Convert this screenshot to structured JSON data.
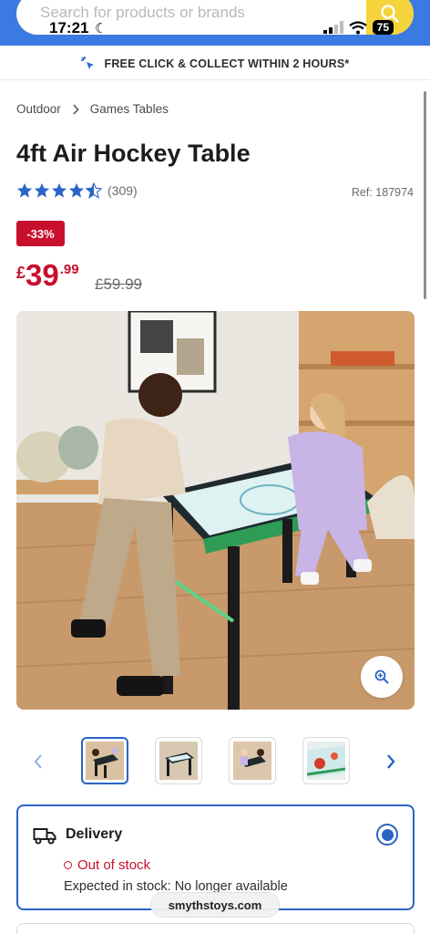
{
  "status_bar": {
    "time": "17:21",
    "battery": "75"
  },
  "search": {
    "placeholder": "Search for products or brands"
  },
  "promo": {
    "text": "FREE CLICK & COLLECT WITHIN 2 HOURS*"
  },
  "breadcrumb": {
    "items": [
      "Outdoor",
      "Games Tables"
    ]
  },
  "product": {
    "title": "4ft Air Hockey Table",
    "rating": 4.5,
    "review_count": "(309)",
    "ref": "Ref: 187974",
    "discount": "-33%",
    "price_currency": "£",
    "price_main": "39",
    "price_decimal": ".99",
    "old_price": "£59.99"
  },
  "delivery": {
    "title": "Delivery",
    "stock_status": "Out of stock",
    "expected": "Expected in stock: No longer available"
  },
  "browser": {
    "url": "smythstoys.com"
  },
  "colors": {
    "brand_blue": "#3b7ae0",
    "accent_blue": "#2a64c7",
    "sale_red": "#c8102e",
    "search_yellow": "#f5d33a"
  }
}
